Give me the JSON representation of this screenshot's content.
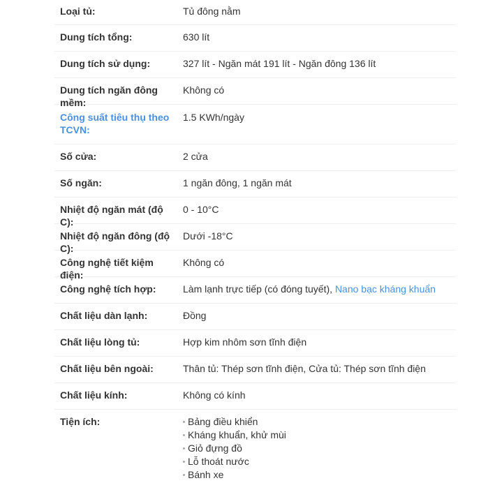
{
  "specs": [
    {
      "label": "Loại tủ:",
      "value": "Tủ đông nằm"
    },
    {
      "label": "Dung tích tổng:",
      "value": "630 lít"
    },
    {
      "label": "Dung tích sử dụng:",
      "value": "327 lít - Ngăn mát 191 lít - Ngăn đông 136 lít"
    },
    {
      "label": "Dung tích ngăn đông mềm:",
      "value": "Không có"
    },
    {
      "label_line1": "Công suất tiêu thụ theo",
      "label_line2": "TCVN:",
      "value": "1.5 KWh/ngày"
    },
    {
      "label": "Số cửa:",
      "value": "2 cửa"
    },
    {
      "label": "Số ngăn:",
      "value": "1 ngăn đông, 1 ngăn mát"
    },
    {
      "label": "Nhiệt độ ngăn mát (độ C):",
      "value": "0 - 10°C"
    },
    {
      "label": "Nhiệt độ ngăn đông (độ C):",
      "value": "Dưới -18°C"
    },
    {
      "label": "Công nghệ tiết kiệm điện:",
      "value": "Không có"
    },
    {
      "label": "Công nghệ tích hợp:",
      "value_text": "Làm lạnh trực tiếp (có đóng tuyết),",
      "value_link": "Nano bạc kháng khuẩn"
    },
    {
      "label": "Chất liệu dàn lạnh:",
      "value": "Đồng"
    },
    {
      "label": "Chất liệu lòng tủ:",
      "value": "Hợp kim nhôm sơn tĩnh điện"
    },
    {
      "label": "Chất liệu bên ngoài:",
      "value": "Thân tủ: Thép sơn tĩnh điện, Cửa tủ: Thép sơn tĩnh điện"
    },
    {
      "label": "Chất liệu kính:",
      "value": "Không có kính"
    },
    {
      "label": "Tiện ích:",
      "items": [
        "Bảng điều khiển",
        "Kháng khuẩn, khử mùi",
        "Giỏ đựng đồ",
        "Lỗ thoát nước",
        "Bánh xe"
      ]
    }
  ],
  "colors": {
    "link": "#4a90e2",
    "text": "#333333",
    "divider": "#eeeeee"
  }
}
